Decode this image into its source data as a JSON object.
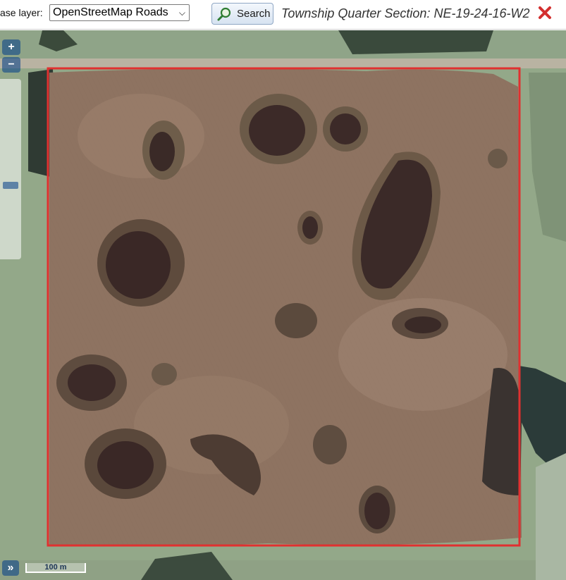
{
  "toolbar": {
    "base_layer_label": "ase layer:",
    "base_layer_value": "OpenStreetMap Roads",
    "search_label": "Search",
    "township_text": "Township Quarter Section: NE-19-24-16-W2"
  },
  "map": {
    "zoom_in": "+",
    "zoom_out": "−",
    "expand": "»",
    "scale_label": "100 m"
  },
  "colors": {
    "boundary": "#e03030",
    "field": "#8e7361",
    "pasture": "#93a889",
    "water": "#3c2a28"
  }
}
